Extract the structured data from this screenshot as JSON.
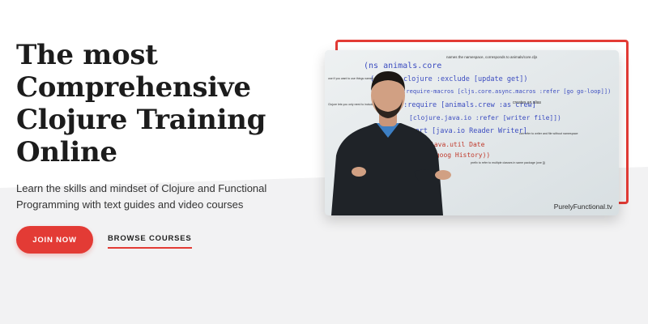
{
  "hero": {
    "title_lines": [
      "The most",
      "Comprehensive",
      "Clojure Training",
      "Online"
    ],
    "subtitle": "Learn the skills and mindset of Clojure and Functional Programming with text guides and video courses"
  },
  "actions": {
    "join_label": "JOIN NOW",
    "browse_label": "BROWSE COURSES"
  },
  "video": {
    "watermark": "PurelyFunctional.tv",
    "whiteboard_lines": [
      "(ns animals.core",
      "(:refer-clojure :exclude [update get])",
      "(:require-macros [cljs.core.async.macros :refer [go go-loop]])",
      "(:require [animals.crew :as crew]",
      "[clojure.java.io :refer [writer file]])",
      "(:import [java.io Reader Writer]",
      "java.util Date",
      "(goog History))"
    ],
    "whiteboard_notes": [
      "names the namespace, corresponds to animals/core.cljs",
      "use if you want to use things named update or get",
      "Clojure lets you only need to include macros",
      "creates an alias",
      "can refer to writer and file without namespace",
      "prefix to refer to multiple classes in same package (one [])"
    ]
  },
  "colors": {
    "accent": "#e33b35",
    "heading": "#1c1c1c",
    "background_band": "#f1f1f2"
  }
}
